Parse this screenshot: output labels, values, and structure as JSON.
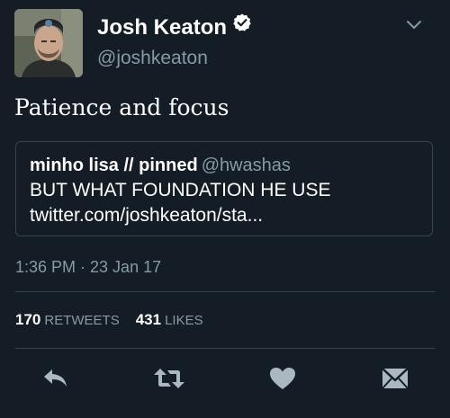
{
  "author": {
    "display_name": "Josh Keaton",
    "handle": "@joshkeaton",
    "verified_icon": "verified-badge-icon",
    "avatar": "profile-photo"
  },
  "menu_icon": "chevron-down-icon",
  "tweet": {
    "text": "Patience and focus"
  },
  "quoted_tweet": {
    "name": "minho lisa // pinned",
    "handle": "@hwashas",
    "line1": "BUT WHAT FOUNDATION HE USE",
    "line2": "twitter.com/joshkeaton/sta..."
  },
  "timestamp": "1:36 PM · 23 Jan 17",
  "stats": {
    "retweets_count": "170",
    "retweets_label": "RETWEETS",
    "likes_count": "431",
    "likes_label": "LIKES"
  },
  "actions": [
    {
      "icon": "reply-icon"
    },
    {
      "icon": "retweet-icon"
    },
    {
      "icon": "heart-icon"
    },
    {
      "icon": "direct-message-icon"
    }
  ],
  "colors": {
    "background": "#141d26",
    "secondary_text": "#8899a6",
    "border": "#38444d",
    "primary_text": "#ffffff",
    "icon": "#aab8c2"
  }
}
